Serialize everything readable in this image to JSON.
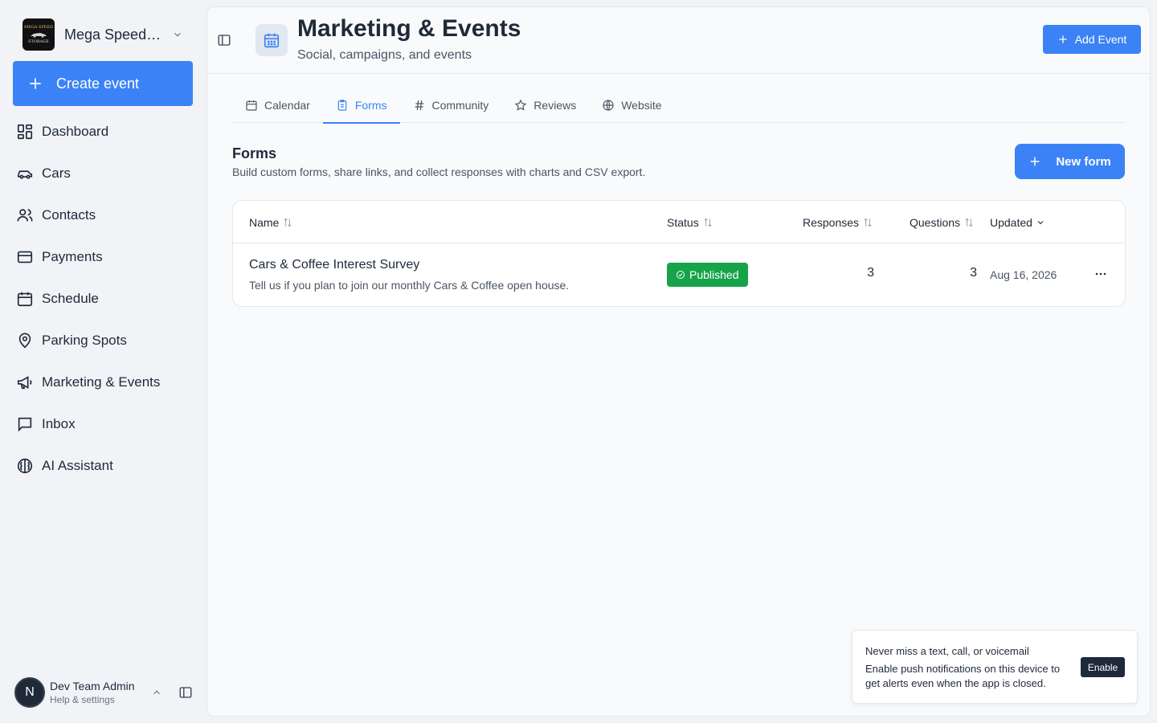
{
  "brand": {
    "name": "Mega Speed Storage",
    "logo_top": "MEGA SPEED",
    "logo_bottom": "STORAGE"
  },
  "sidebar": {
    "create_label": "Create event",
    "items": [
      {
        "label": "Dashboard",
        "icon": "dashboard-icon"
      },
      {
        "label": "Cars",
        "icon": "car-icon"
      },
      {
        "label": "Contacts",
        "icon": "contacts-icon"
      },
      {
        "label": "Payments",
        "icon": "credit-card-icon"
      },
      {
        "label": "Schedule",
        "icon": "calendar-icon"
      },
      {
        "label": "Parking Spots",
        "icon": "map-pin-icon"
      },
      {
        "label": "Marketing & Events",
        "icon": "megaphone-icon"
      },
      {
        "label": "Inbox",
        "icon": "message-icon"
      },
      {
        "label": "AI Assistant",
        "icon": "brain-icon"
      }
    ]
  },
  "user": {
    "initial": "N",
    "name": "Dev Team Admin",
    "subtitle": "Help & settings"
  },
  "header": {
    "title": "Marketing & Events",
    "subtitle": "Social, campaigns, and events",
    "add_event_label": "Add Event"
  },
  "tabs": [
    {
      "label": "Calendar",
      "active": false
    },
    {
      "label": "Forms",
      "active": true
    },
    {
      "label": "Community",
      "active": false
    },
    {
      "label": "Reviews",
      "active": false
    },
    {
      "label": "Website",
      "active": false
    }
  ],
  "forms_section": {
    "title": "Forms",
    "subtitle": "Build custom forms, share links, and collect responses with charts and CSV export.",
    "new_form_label": "New form"
  },
  "table": {
    "columns": [
      "Name",
      "Status",
      "Responses",
      "Questions",
      "Updated"
    ],
    "rows": [
      {
        "name": "Cars & Coffee Interest Survey",
        "description": "Tell us if you plan to join our monthly Cars & Coffee open house.",
        "status": "Published",
        "responses": "3",
        "questions": "3",
        "updated": "Aug 16, 2026"
      }
    ]
  },
  "toast": {
    "title": "Never miss a text, call, or voicemail",
    "body": "Enable push notifications on this device to get alerts even when the app is closed.",
    "button": "Enable"
  },
  "colors": {
    "accent": "#3b82f6",
    "published": "#16a34a",
    "dark": "#1e293b"
  }
}
